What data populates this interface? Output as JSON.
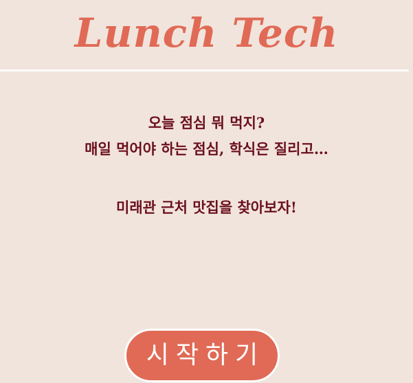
{
  "header": {
    "logo_text": "Lunch Tech"
  },
  "intro": {
    "line1": "오늘 점심 뭐 먹지?",
    "line2": "매일 먹어야 하는 점심, 학식은 질리고…",
    "line3": "미래관 근처 맛집을 찾아보자!"
  },
  "start_button": {
    "label": "시작하기"
  },
  "colors": {
    "background": "#f1e4dc",
    "accent": "#e06a56",
    "text": "#6a0f1c"
  }
}
